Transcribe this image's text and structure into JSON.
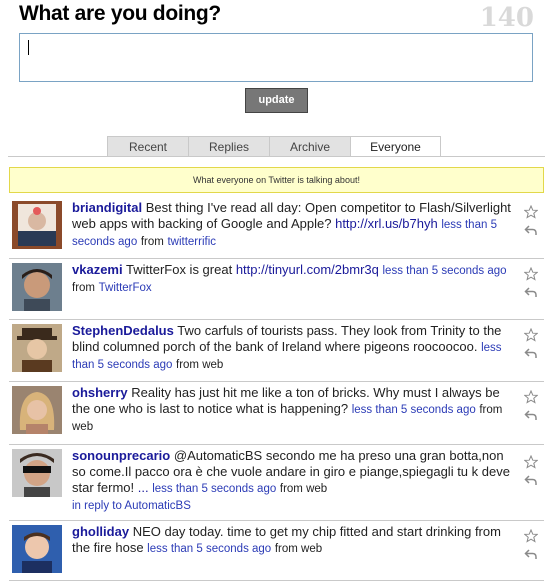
{
  "header": {
    "title": "What are you doing?",
    "counter": "140"
  },
  "status_input": {
    "value": ""
  },
  "update_button": {
    "label": "update"
  },
  "tabs": [
    {
      "label": "Recent",
      "active": false
    },
    {
      "label": "Replies",
      "active": false
    },
    {
      "label": "Archive",
      "active": false
    },
    {
      "label": "Everyone",
      "active": true
    }
  ],
  "notice": "What everyone on Twitter is talking about!",
  "tweets": [
    {
      "user": "briandigital",
      "text": "Best thing I've read all day: Open competitor to Flash/Silverlight web apps with backing of Google and Apple?",
      "link": "http://xrl.us/b7hyh",
      "text_after": "",
      "time": "less than 5 seconds ago",
      "from": "from",
      "source": "twitterrific",
      "in_reply": ""
    },
    {
      "user": "vkazemi",
      "text": "TwitterFox is great",
      "link": "http://tinyurl.com/2bmr3q",
      "text_after": "",
      "time": "less than 5 seconds ago",
      "from": "from",
      "source": "TwitterFox",
      "in_reply": ""
    },
    {
      "user": "StephenDedalus",
      "text": "Two carfuls of tourists pass. They look from Trinity to the blind columned porch of the bank of Ireland where pigeons roocoocoo.",
      "link": "",
      "text_after": "",
      "time": "less than 5 seconds ago",
      "from": "from web",
      "source": "",
      "in_reply": ""
    },
    {
      "user": "ohsherry",
      "text": "Reality has just hit me like a ton of bricks. Why must I always be the one who is last to notice what is happening?",
      "link": "",
      "text_after": "",
      "time": "less than 5 seconds ago",
      "from": "from web",
      "source": "",
      "in_reply": ""
    },
    {
      "user": "sonounprecario",
      "text": "@AutomaticBS secondo me ha preso una gran botta,non so come.Il pacco ora è che vuole andare in giro e piange,spiegagli tu k deve star fermo!",
      "link": "...",
      "text_after": "",
      "time": "less than 5 seconds ago",
      "from": "from web",
      "source": "",
      "in_reply": "in reply to AutomaticBS"
    },
    {
      "user": "gholliday",
      "text": "NEO day today. time to get my chip fitted and start drinking from the fire hose",
      "link": "",
      "text_after": "",
      "time": "less than 5 seconds ago",
      "from": "from web",
      "source": "",
      "in_reply": ""
    }
  ],
  "icons": {
    "favorite": "star-icon",
    "reply": "reply-icon"
  }
}
